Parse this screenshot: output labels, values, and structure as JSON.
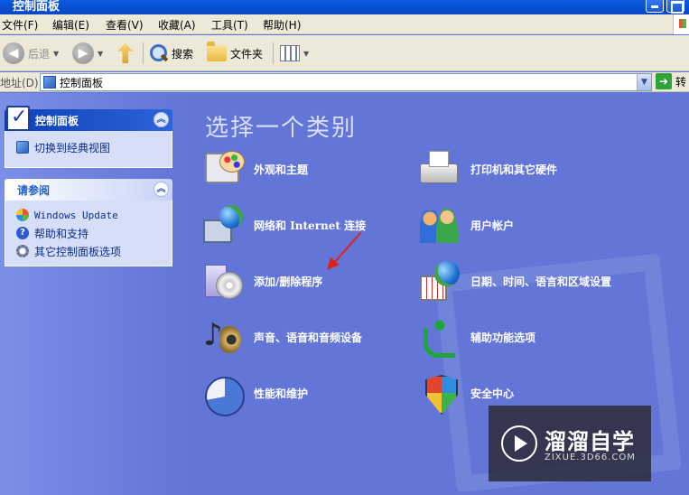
{
  "window": {
    "title": "控制面板"
  },
  "menu": [
    "文件(F)",
    "编辑(E)",
    "查看(V)",
    "收藏(A)",
    "工具(T)",
    "帮助(H)"
  ],
  "toolbar": {
    "back_label": "后退",
    "search_label": "搜索",
    "folders_label": "文件夹"
  },
  "address": {
    "label": "地址(D)",
    "value": "控制面板",
    "go_label": "转"
  },
  "sidebar": {
    "control_panel": {
      "title": "控制面板",
      "switch_label": "切换到经典视图"
    },
    "see_also": {
      "title": "请参阅",
      "items": [
        "Windows Update",
        "帮助和支持",
        "其它控制面板选项"
      ]
    }
  },
  "main": {
    "heading": "选择一个类别",
    "categories": [
      "外观和主题",
      "打印机和其它硬件",
      "网络和 Internet 连接",
      "用户帐户",
      "添加/删除程序",
      "日期、时间、语言和区域设置",
      "声音、语音和音频设备",
      "辅助功能选项",
      "性能和维护",
      "安全中心"
    ]
  },
  "watermark": {
    "name": "溜溜自学",
    "url": "ZIXUE.3D66.COM"
  },
  "colors": {
    "background": "#6375d6",
    "sidebar_header": "#0c3fb8",
    "annotation_arrow": "#e0201b"
  }
}
